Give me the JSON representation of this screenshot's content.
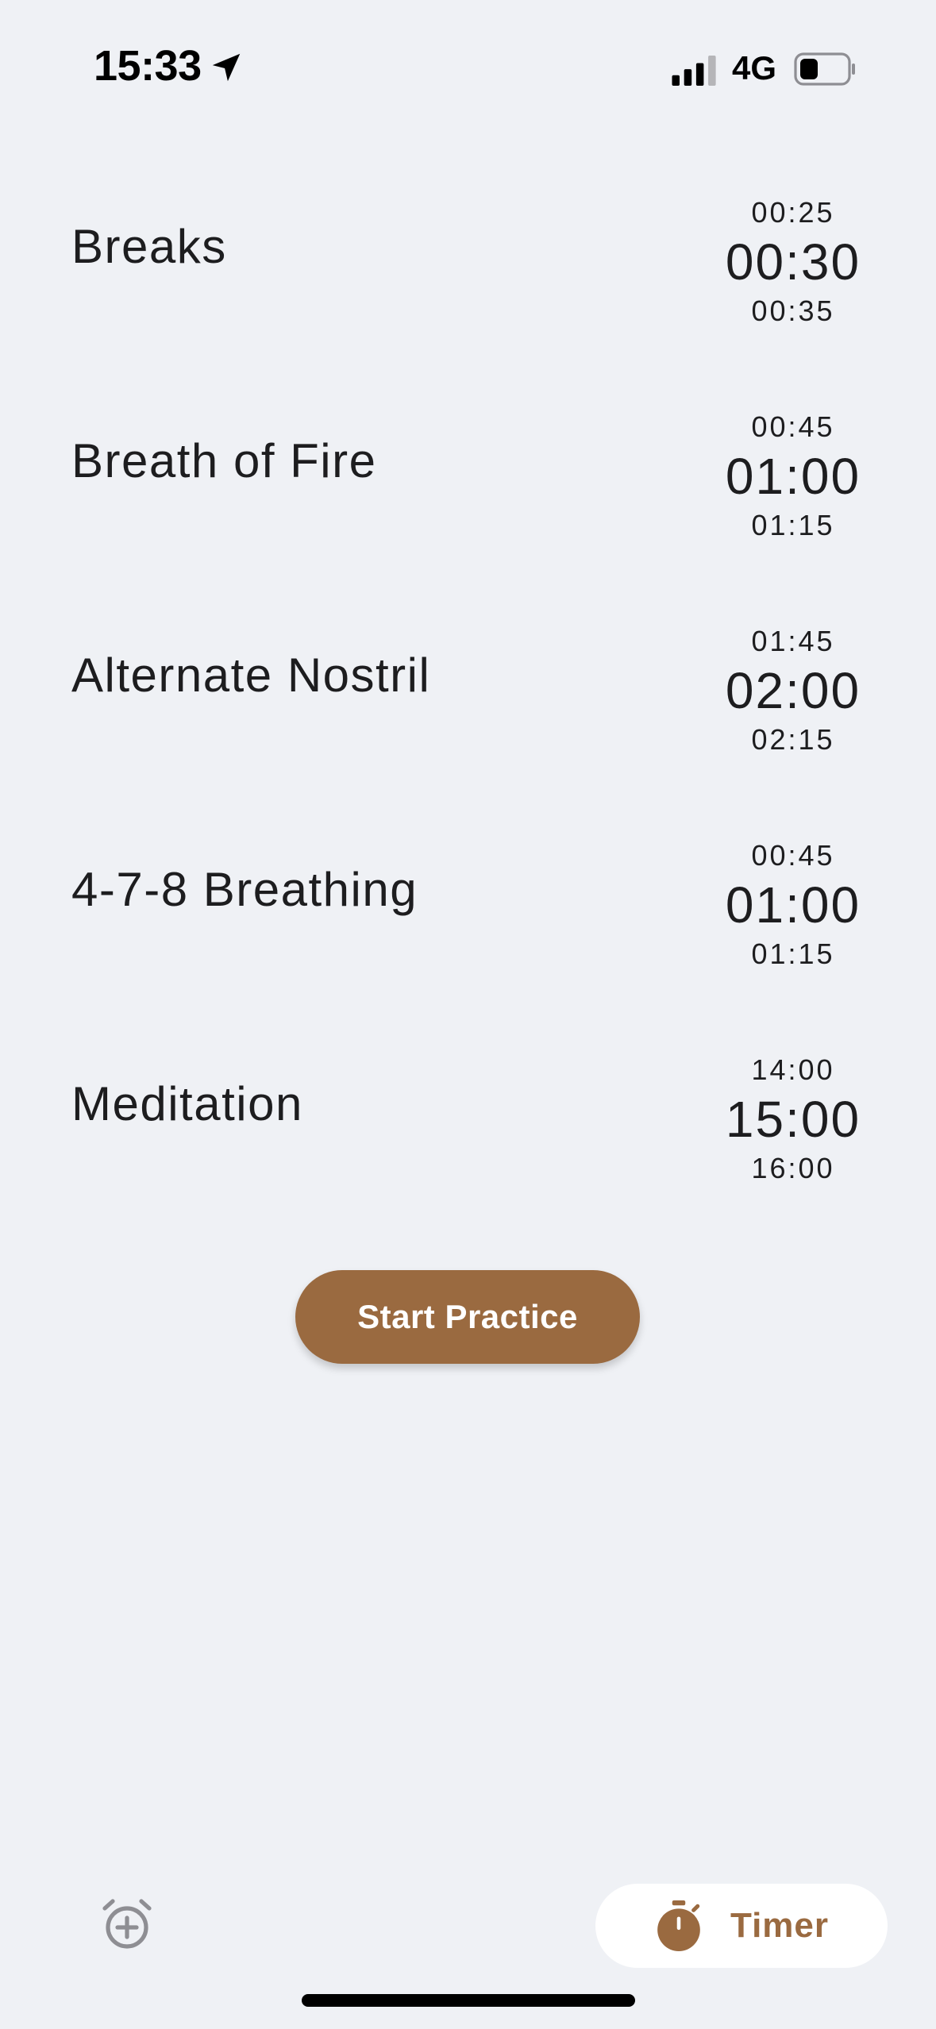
{
  "status_bar": {
    "time": "15:33",
    "network": "4G"
  },
  "timers": [
    {
      "name": "Breaks",
      "prev": "00:25",
      "current": "00:30",
      "next": "00:35"
    },
    {
      "name": "Breath of Fire",
      "prev": "00:45",
      "current": "01:00",
      "next": "01:15"
    },
    {
      "name": "Alternate Nostril",
      "prev": "01:45",
      "current": "02:00",
      "next": "02:15"
    },
    {
      "name": "4-7-8 Breathing",
      "prev": "00:45",
      "current": "01:00",
      "next": "01:15"
    },
    {
      "name": "Meditation",
      "prev": "14:00",
      "current": "15:00",
      "next": "16:00"
    }
  ],
  "start_button_label": "Start Practice",
  "tab_bar": {
    "add_icon": "alarm-add-icon",
    "timer_icon": "stopwatch-icon",
    "timer_label": "Timer"
  },
  "colors": {
    "accent": "#9a6a40",
    "background": "#eff1f5",
    "text": "#1d1d1f"
  }
}
